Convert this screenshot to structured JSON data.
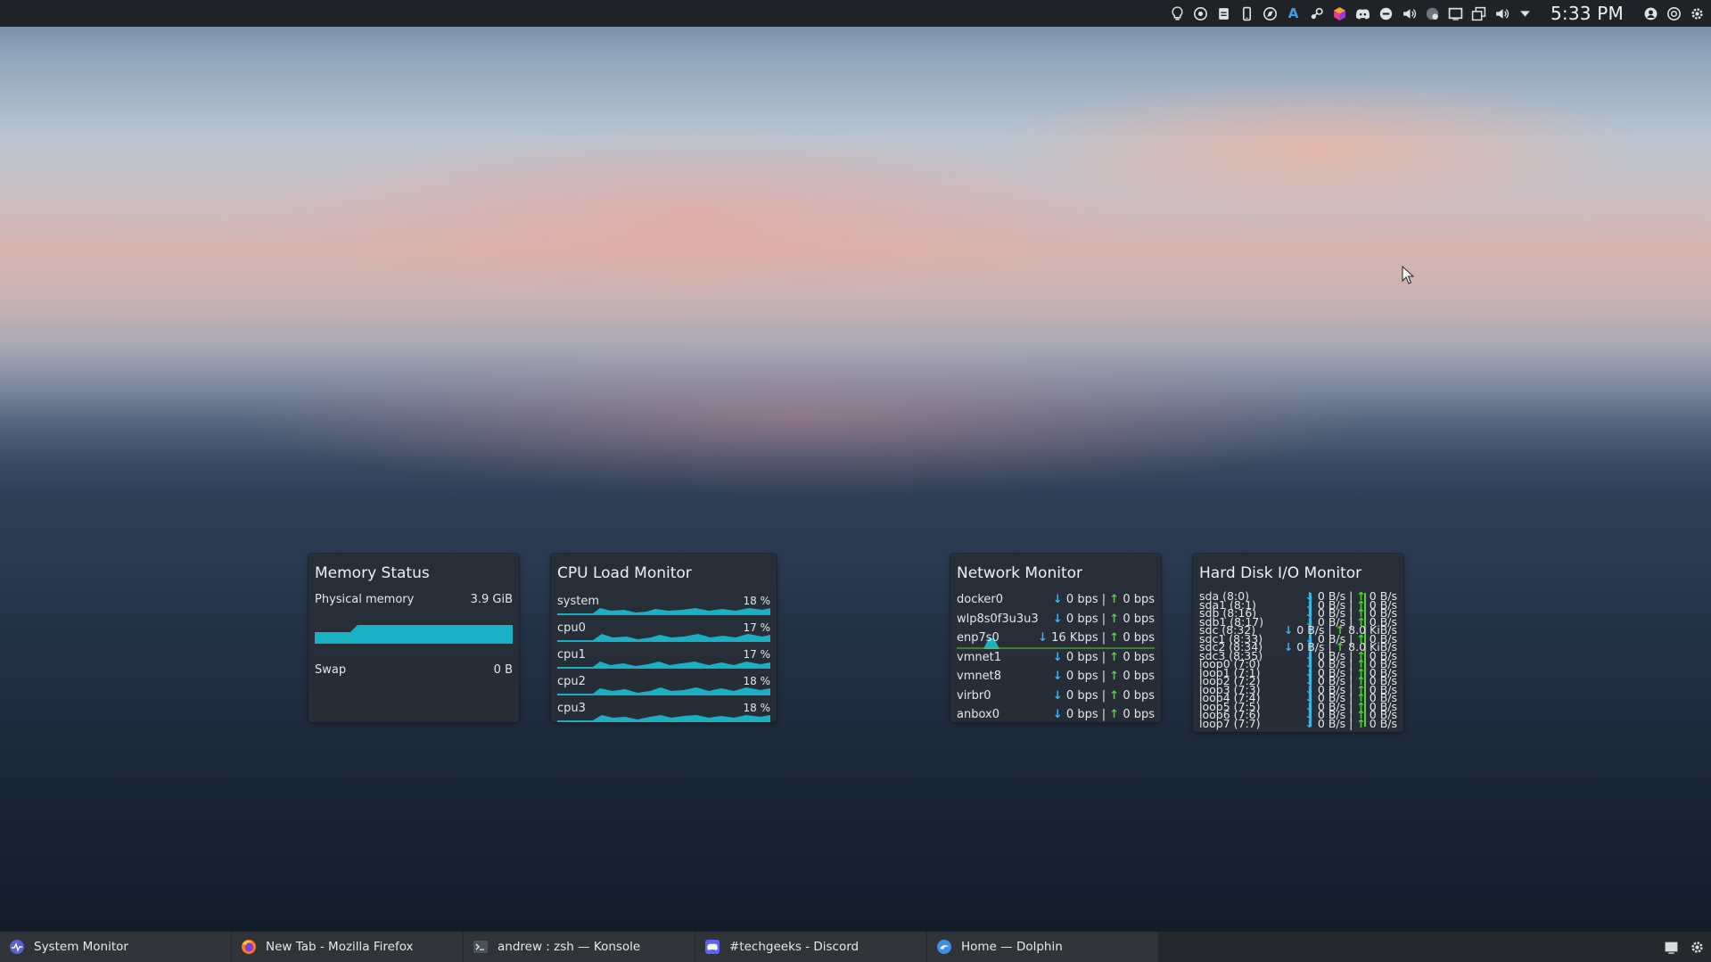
{
  "top_panel": {
    "clock": "5:33 PM",
    "tray_icons": [
      "lightbulb-icon",
      "help-circle-icon",
      "clipboard-icon",
      "phone-icon",
      "compass-icon",
      "text-a-icon",
      "steam-icon",
      "color-cube-icon",
      "discord-icon",
      "chat-bubble-icon",
      "volume-icon",
      "network-status-icon",
      "display-icon",
      "window-icon",
      "volume-icon-2",
      "expand-arrow-icon",
      "user-account-icon",
      "power-icon",
      "settings-icon"
    ]
  },
  "memory": {
    "title": "Memory Status",
    "physical_label": "Physical memory",
    "physical_value": "3.9 GiB",
    "swap_label": "Swap",
    "swap_value": "0 B"
  },
  "cpu": {
    "title": "CPU Load Monitor",
    "rows": [
      {
        "name": "system",
        "pct": "18 %"
      },
      {
        "name": "cpu0",
        "pct": "17 %"
      },
      {
        "name": "cpu1",
        "pct": "17 %"
      },
      {
        "name": "cpu2",
        "pct": "18 %"
      },
      {
        "name": "cpu3",
        "pct": "18 %"
      }
    ]
  },
  "network": {
    "title": "Network Monitor",
    "rows": [
      {
        "name": "docker0",
        "down": "0 bps",
        "up": "0 bps"
      },
      {
        "name": "wlp8s0f3u3u3",
        "down": "0 bps",
        "up": "0 bps"
      },
      {
        "name": "enp7s0",
        "down": "16 Kbps",
        "up": "0 bps"
      },
      {
        "name": "vmnet1",
        "down": "0 bps",
        "up": "0 bps"
      },
      {
        "name": "vmnet8",
        "down": "0 bps",
        "up": "0 bps"
      },
      {
        "name": "virbr0",
        "down": "0 bps",
        "up": "0 bps"
      },
      {
        "name": "anbox0",
        "down": "0 bps",
        "up": "0 bps"
      }
    ]
  },
  "disk": {
    "title": "Hard Disk I/O Monitor",
    "rows": [
      {
        "name": "sda (8:0)",
        "read": "0 B/s",
        "write": "0 B/s"
      },
      {
        "name": "sda1 (8:1)",
        "read": "0 B/s",
        "write": "0 B/s"
      },
      {
        "name": "sdb (8:16)",
        "read": "0 B/s",
        "write": "0 B/s"
      },
      {
        "name": "sdb1 (8:17)",
        "read": "0 B/s",
        "write": "0 B/s"
      },
      {
        "name": "sdc (8:32)",
        "read": "0 B/s",
        "write": "8.0 KiB/s"
      },
      {
        "name": "sdc1 (8:33)",
        "read": "0 B/s",
        "write": "0 B/s"
      },
      {
        "name": "sdc2 (8:34)",
        "read": "0 B/s",
        "write": "8.0 KiB/s"
      },
      {
        "name": "sdc3 (8:35)",
        "read": "0 B/s",
        "write": "0 B/s"
      },
      {
        "name": "loop0 (7:0)",
        "read": "0 B/s",
        "write": "0 B/s"
      },
      {
        "name": "loop1 (7:1)",
        "read": "0 B/s",
        "write": "0 B/s"
      },
      {
        "name": "loop2 (7:2)",
        "read": "0 B/s",
        "write": "0 B/s"
      },
      {
        "name": "loop3 (7:3)",
        "read": "0 B/s",
        "write": "0 B/s"
      },
      {
        "name": "loop4 (7:4)",
        "read": "0 B/s",
        "write": "0 B/s"
      },
      {
        "name": "loop5 (7:5)",
        "read": "0 B/s",
        "write": "0 B/s"
      },
      {
        "name": "loop6 (7:6)",
        "read": "0 B/s",
        "write": "0 B/s"
      },
      {
        "name": "loop7 (7:7)",
        "read": "0 B/s",
        "write": "0 B/s"
      }
    ]
  },
  "taskbar": {
    "tasks": [
      {
        "label": "System Monitor",
        "icon": "system-monitor-icon"
      },
      {
        "label": "New Tab - Mozilla Firefox",
        "icon": "firefox-icon"
      },
      {
        "label": "andrew : zsh — Konsole",
        "icon": "terminal-icon"
      },
      {
        "label": "#techgeeks - Discord",
        "icon": "discord-icon"
      },
      {
        "label": "Home — Dolphin",
        "icon": "dolphin-icon"
      }
    ]
  },
  "colors": {
    "graph_cyan": "#1ab0c4",
    "download_blue": "#3ab5e6",
    "upload_green": "#57d13a",
    "panel_bg": "#1f2327"
  }
}
